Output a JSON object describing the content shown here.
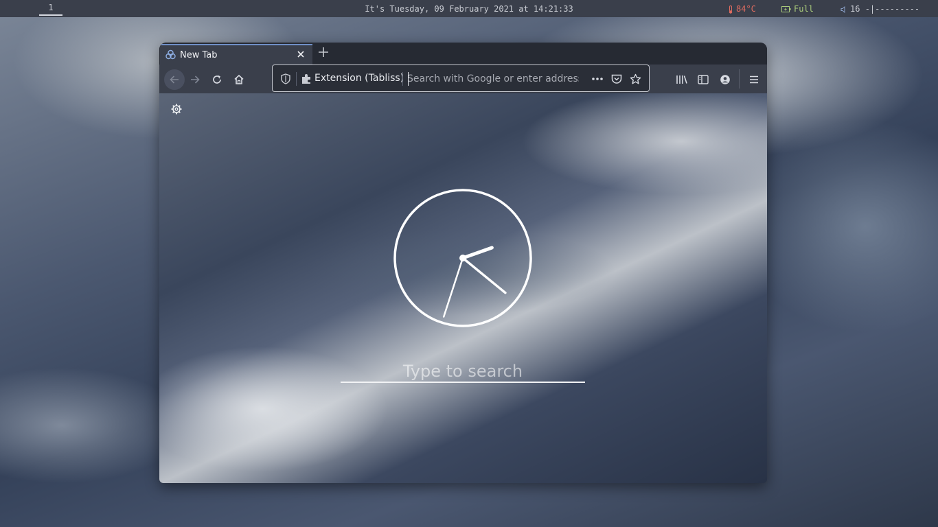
{
  "topbar": {
    "workspace": "1",
    "datetime": "It's Tuesday, 09 February 2021 at 14:21:33",
    "temperature": "84°C",
    "battery": "Full",
    "volume_value": "16",
    "volume_bar": "-|---------",
    "colors": {
      "temperature": "#e06c60",
      "battery": "#a8c97a"
    }
  },
  "browser": {
    "tab": {
      "title": "New Tab"
    },
    "urlbar": {
      "identity_label": "Extension (Tabliss)",
      "placeholder": "Search with Google or enter address",
      "value": ""
    },
    "icons": {
      "tab": "tabliss-icon",
      "back": "arrow-left-icon",
      "forward": "arrow-right-icon",
      "reload": "reload-icon",
      "home": "home-icon",
      "library": "library-icon",
      "sidebar": "sidebar-icon",
      "account": "account-icon",
      "menu": "hamburger-menu-icon"
    },
    "accent": "#6f8fc7"
  },
  "newtab": {
    "search_placeholder": "Type to search",
    "clock_time": "14:21:33"
  }
}
